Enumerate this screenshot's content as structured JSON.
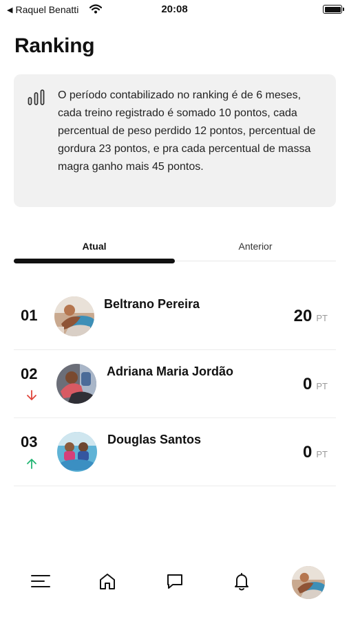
{
  "status_bar": {
    "back_label": "Raquel Benatti",
    "time": "20:08"
  },
  "page": {
    "title": "Ranking"
  },
  "info": {
    "icon": "bar-chart-icon",
    "text": "O período contabilizado no ranking é de 6 meses, cada treino registrado é somado 10 pontos, cada percentual de peso perdido 12 pontos, percentual de gordura 23 pontos, e pra cada percentual de massa magra ganho mais 45 pontos."
  },
  "tabs": {
    "current": "Atual",
    "previous": "Anterior",
    "selected": "Atual"
  },
  "ranking": [
    {
      "position": "01",
      "name": "Beltrano Pereira",
      "points": "20",
      "unit": "PT",
      "trend": "none"
    },
    {
      "position": "02",
      "name": "Adriana Maria Jordão",
      "points": "0",
      "unit": "PT",
      "trend": "down",
      "trend_color": "#e0443a"
    },
    {
      "position": "03",
      "name": "Douglas Santos",
      "points": "0",
      "unit": "PT",
      "trend": "up",
      "trend_color": "#22b573"
    }
  ],
  "bottom_nav": {
    "items": [
      "menu-icon",
      "home-icon",
      "chat-icon",
      "bell-icon",
      "profile-avatar"
    ]
  }
}
